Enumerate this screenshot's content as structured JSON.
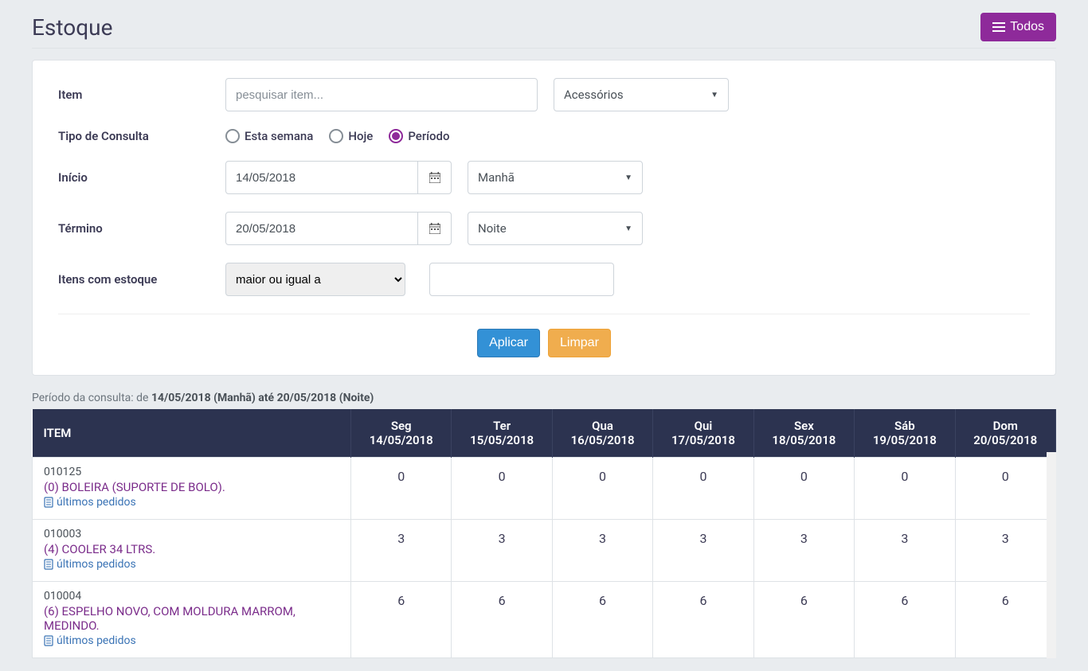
{
  "header": {
    "title": "Estoque",
    "todos_button": "Todos"
  },
  "form": {
    "item_label": "Item",
    "item_placeholder": "pesquisar item...",
    "category_selected": "Acessórios",
    "tipo_label": "Tipo de Consulta",
    "radio_options": {
      "esta_semana": "Esta semana",
      "hoje": "Hoje",
      "periodo": "Período"
    },
    "inicio_label": "Início",
    "inicio_value": "14/05/2018",
    "inicio_period_selected": "Manhã",
    "termino_label": "Término",
    "termino_value": "20/05/2018",
    "termino_period_selected": "Noite",
    "estoque_label": "Itens com estoque",
    "estoque_condition_selected": "maior ou igual a",
    "apply_button": "Aplicar",
    "clear_button": "Limpar"
  },
  "summary": {
    "prefix": "Período da consulta: de ",
    "range": "14/05/2018 (Manhã) até 20/05/2018 (Noite)"
  },
  "table": {
    "headers": {
      "item": "ITEM",
      "days": [
        {
          "dow": "Seg",
          "date": "14/05/2018"
        },
        {
          "dow": "Ter",
          "date": "15/05/2018"
        },
        {
          "dow": "Qua",
          "date": "16/05/2018"
        },
        {
          "dow": "Qui",
          "date": "17/05/2018"
        },
        {
          "dow": "Sex",
          "date": "18/05/2018"
        },
        {
          "dow": "Sáb",
          "date": "19/05/2018"
        },
        {
          "dow": "Dom",
          "date": "20/05/2018"
        }
      ]
    },
    "last_orders_label": "últimos pedidos",
    "rows": [
      {
        "code": "010125",
        "name": "(0) BOLEIRA (SUPORTE DE BOLO).",
        "values": [
          0,
          0,
          0,
          0,
          0,
          0,
          0
        ]
      },
      {
        "code": "010003",
        "name": "(4) COOLER 34 LTRS.",
        "values": [
          3,
          3,
          3,
          3,
          3,
          3,
          3
        ]
      },
      {
        "code": "010004",
        "name": "(6) ESPELHO NOVO, COM MOLDURA MARROM, MEDINDO.",
        "values": [
          6,
          6,
          6,
          6,
          6,
          6,
          6
        ]
      }
    ]
  }
}
